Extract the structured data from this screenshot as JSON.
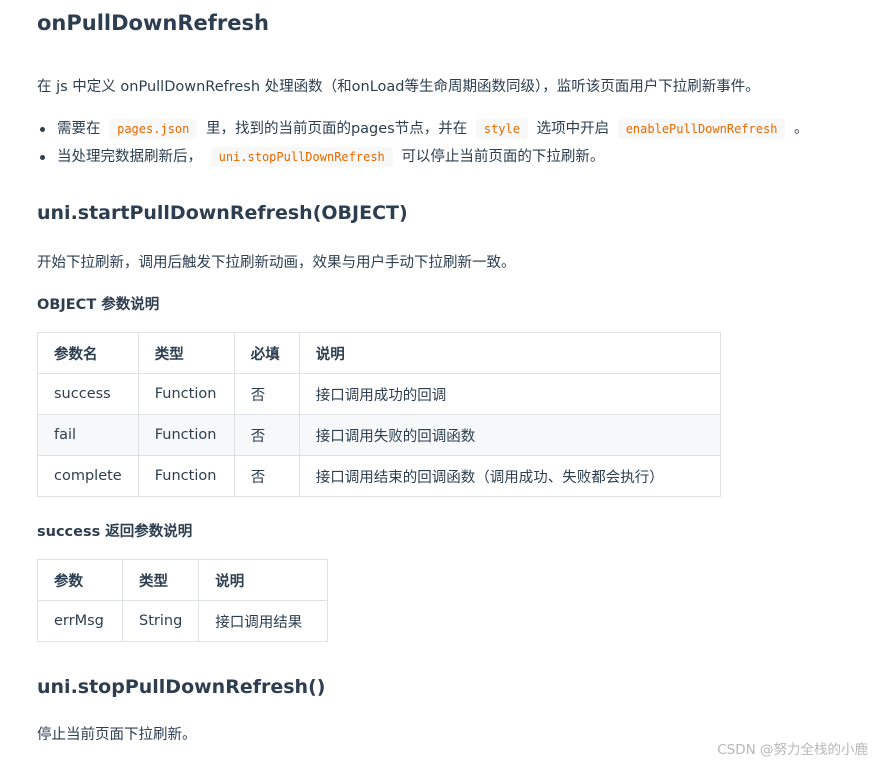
{
  "section1": {
    "title": "onPullDownRefresh",
    "intro": "在 js 中定义 onPullDownRefresh 处理函数（和onLoad等生命周期函数同级），监听该页面用户下拉刷新事件。",
    "bullet1": {
      "t1": "需要在",
      "c1": "pages.json",
      "t2": "里，找到的当前页面的pages节点，并在",
      "c2": "style",
      "t3": "选项中开启",
      "c3": "enablePullDownRefresh",
      "t4": "。"
    },
    "bullet2": {
      "t1": "当处理完数据刷新后，",
      "c1": "uni.stopPullDownRefresh",
      "t2": "可以停止当前页面的下拉刷新。"
    }
  },
  "section2": {
    "title": "uni.startPullDownRefresh(OBJECT)",
    "desc": "开始下拉刷新，调用后触发下拉刷新动画，效果与用户手动下拉刷新一致。",
    "object_heading": "OBJECT 参数说明",
    "object_table": {
      "headers": [
        "参数名",
        "类型",
        "必填",
        "说明"
      ],
      "rows": [
        [
          "success",
          "Function",
          "否",
          "接口调用成功的回调"
        ],
        [
          "fail",
          "Function",
          "否",
          "接口调用失败的回调函数"
        ],
        [
          "complete",
          "Function",
          "否",
          "接口调用结束的回调函数（调用成功、失败都会执行）"
        ]
      ]
    },
    "success_heading": "success 返回参数说明",
    "success_table": {
      "headers": [
        "参数",
        "类型",
        "说明"
      ],
      "rows": [
        [
          "errMsg",
          "String",
          "接口调用结果"
        ]
      ]
    }
  },
  "section3": {
    "title": "uni.stopPullDownRefresh()",
    "desc": "停止当前页面下拉刷新。"
  },
  "watermark": "CSDN @努力全栈的小鹿",
  "colors": {
    "text": "#2c3e50",
    "code_text": "#e96900",
    "code_bg": "#f8f8f8",
    "table_border": "#dfe2e5",
    "stripe": "#f6f8fa"
  }
}
